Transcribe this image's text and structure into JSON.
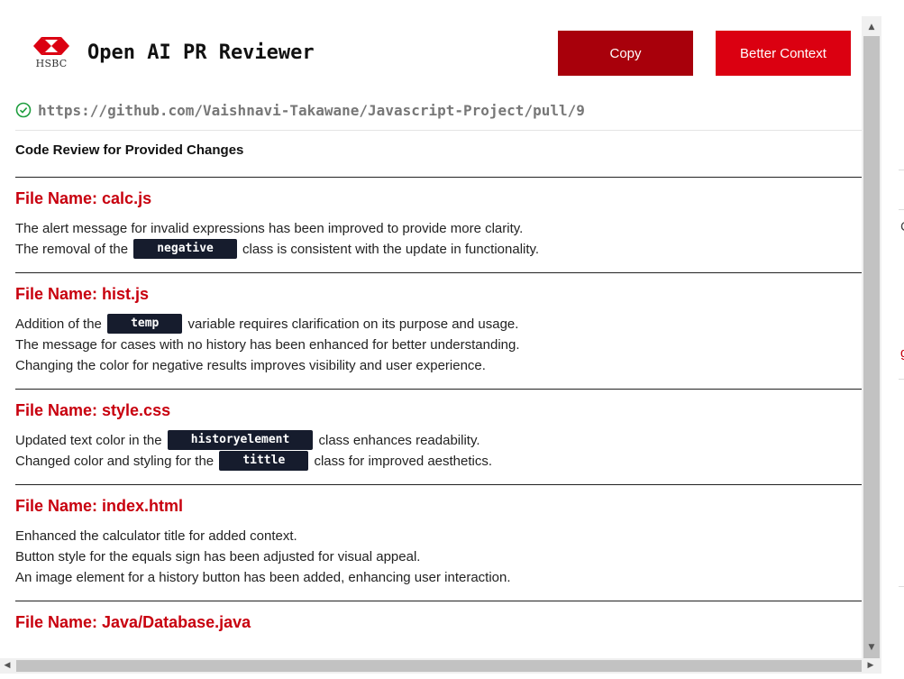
{
  "app": {
    "logo_text": "HSBC",
    "title": "Open AI PR Reviewer",
    "brand_red": "#db0011",
    "copy_label": "Copy",
    "context_label": "Better Context"
  },
  "url": {
    "status_icon": "check-circle-icon",
    "text": "https://github.com/Vaishnavi-Takawane/Javascript-Project/pull/9"
  },
  "review": {
    "heading": "Code Review for Provided Changes",
    "files": [
      {
        "title": "File Name: calc.js",
        "lines": [
          {
            "parts": [
              {
                "t": "The alert message for invalid expressions has been improved to provide more clarity."
              }
            ]
          },
          {
            "parts": [
              {
                "t": "The removal of the "
              },
              {
                "code": "negative"
              },
              {
                "t": " class is consistent with the update in functionality."
              }
            ]
          }
        ]
      },
      {
        "title": "File Name: hist.js",
        "lines": [
          {
            "parts": [
              {
                "t": "Addition of the "
              },
              {
                "code": "temp"
              },
              {
                "t": " variable requires clarification on its purpose and usage."
              }
            ]
          },
          {
            "parts": [
              {
                "t": "The message for cases with no history has been enhanced for better understanding."
              }
            ]
          },
          {
            "parts": [
              {
                "t": "Changing the color for negative results improves visibility and user experience."
              }
            ]
          }
        ]
      },
      {
        "title": "File Name: style.css",
        "lines": [
          {
            "parts": [
              {
                "t": "Updated text color in the "
              },
              {
                "code": "historyelement"
              },
              {
                "t": " class enhances readability."
              }
            ]
          },
          {
            "parts": [
              {
                "t": "Changed color and styling for the "
              },
              {
                "code": "tittle"
              },
              {
                "t": " class for improved aesthetics."
              }
            ]
          }
        ]
      },
      {
        "title": "File Name: index.html",
        "lines": [
          {
            "parts": [
              {
                "t": "Enhanced the calculator title for added context."
              }
            ]
          },
          {
            "parts": [
              {
                "t": "Button style for the equals sign has been adjusted for visual appeal."
              }
            ]
          },
          {
            "parts": [
              {
                "t": "An image element for a history button has been added, enhancing user interaction."
              }
            ]
          }
        ]
      },
      {
        "title": "File Name: Java/Database.java",
        "lines": []
      }
    ]
  },
  "scrollbars": {
    "up_icon": "arrow-up-icon",
    "down_icon": "arrow-down-icon",
    "left_icon": "arrow-left-icon",
    "right_icon": "arrow-right-icon"
  },
  "edge": {
    "chars": [
      "C",
      "g"
    ]
  }
}
